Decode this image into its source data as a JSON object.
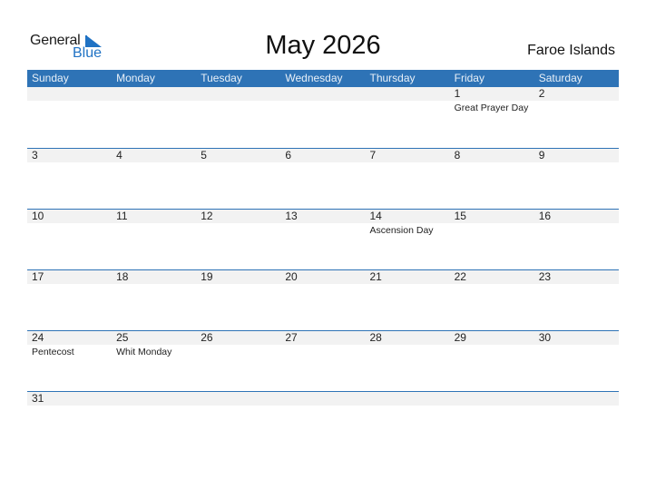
{
  "logo": {
    "line1": "General",
    "line2": "Blue"
  },
  "title": "May 2026",
  "country": "Faroe Islands",
  "colors": {
    "header_bg": "#2e73b6",
    "brand_blue": "#1f72c4",
    "date_strip": "#f2f2f2"
  },
  "weekdays": [
    "Sunday",
    "Monday",
    "Tuesday",
    "Wednesday",
    "Thursday",
    "Friday",
    "Saturday"
  ],
  "weeks": [
    [
      {
        "d": ""
      },
      {
        "d": ""
      },
      {
        "d": ""
      },
      {
        "d": ""
      },
      {
        "d": ""
      },
      {
        "d": "1",
        "h": "Great Prayer Day"
      },
      {
        "d": "2"
      }
    ],
    [
      {
        "d": "3"
      },
      {
        "d": "4"
      },
      {
        "d": "5"
      },
      {
        "d": "6"
      },
      {
        "d": "7"
      },
      {
        "d": "8"
      },
      {
        "d": "9"
      }
    ],
    [
      {
        "d": "10"
      },
      {
        "d": "11"
      },
      {
        "d": "12"
      },
      {
        "d": "13"
      },
      {
        "d": "14",
        "h": "Ascension Day"
      },
      {
        "d": "15"
      },
      {
        "d": "16"
      }
    ],
    [
      {
        "d": "17"
      },
      {
        "d": "18"
      },
      {
        "d": "19"
      },
      {
        "d": "20"
      },
      {
        "d": "21"
      },
      {
        "d": "22"
      },
      {
        "d": "23"
      }
    ],
    [
      {
        "d": "24",
        "h": "Pentecost"
      },
      {
        "d": "25",
        "h": "Whit Monday"
      },
      {
        "d": "26"
      },
      {
        "d": "27"
      },
      {
        "d": "28"
      },
      {
        "d": "29"
      },
      {
        "d": "30"
      }
    ],
    [
      {
        "d": "31"
      },
      {
        "d": ""
      },
      {
        "d": ""
      },
      {
        "d": ""
      },
      {
        "d": ""
      },
      {
        "d": ""
      },
      {
        "d": ""
      }
    ]
  ]
}
